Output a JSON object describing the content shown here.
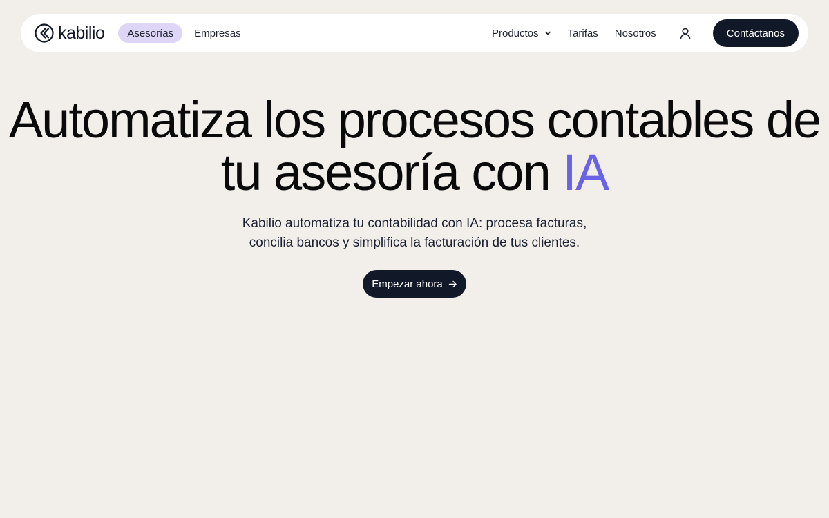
{
  "nav": {
    "brand": "kabilio",
    "segments": [
      {
        "label": "Asesorías",
        "active": true
      },
      {
        "label": "Empresas",
        "active": false
      }
    ],
    "links": {
      "products": "Productos",
      "pricing": "Tarifas",
      "about": "Nosotros"
    },
    "contact_label": "Contáctanos"
  },
  "hero": {
    "title_main": "Automatiza los procesos contables de tu asesoría con",
    "title_accent": "IA",
    "subtitle_line1": "Kabilio automatiza tu contabilidad con IA: procesa facturas,",
    "subtitle_line2": "concilia bancos y simplifica la facturación de tus clientes.",
    "cta_label": "Empezar ahora"
  },
  "icons": {
    "logo": "kabilio-logo-icon",
    "products_dropdown": "chevron-down-icon",
    "account": "user-icon",
    "cta_arrow": "arrow-right-icon"
  },
  "colors": {
    "background": "#f2efeb",
    "dark": "#111827",
    "accent": "#6b63e6",
    "active_segment": "#ddd6f7"
  }
}
